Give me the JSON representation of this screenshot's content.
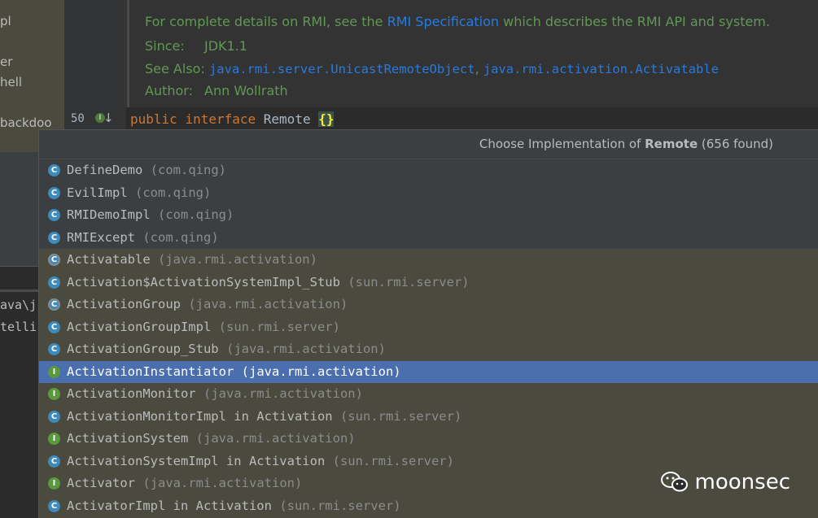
{
  "left_panel": {
    "items": [
      "pl",
      "er",
      "hell",
      "backdoo"
    ],
    "terminal_lines": [
      "ava\\j",
      "telli"
    ]
  },
  "editor": {
    "line_number": "50",
    "doc": {
      "line1_prefix": "For complete details on RMI, see the ",
      "line1_link": "RMI Specification",
      "line1_suffix": " which describes the RMI API and system.",
      "since_label": "Since:",
      "since_value": "JDK1.1",
      "see_also_label": "See Also:",
      "see_also_link1": "java.rmi.server.UnicastRemoteObject",
      "see_also_sep": ",",
      "see_also_link2": "java.rmi.activation.Activatable",
      "author_label": "Author:",
      "author_value": "Ann Wollrath"
    },
    "code": {
      "kw1": "public",
      "kw2": "interface",
      "name": "Remote",
      "braces": "{}"
    }
  },
  "popup": {
    "title_prefix": "Choose Implementation of ",
    "title_bold": "Remote",
    "title_suffix": " (656 found)",
    "rows": [
      {
        "name": "DefineDemo",
        "pkg": "(com.qing)",
        "icon": "class-icon",
        "group": "project"
      },
      {
        "name": "EvilImpl",
        "pkg": "(com.qing)",
        "icon": "class-icon",
        "group": "project"
      },
      {
        "name": "RMIDemoImpl",
        "pkg": "(com.qing)",
        "icon": "class-icon",
        "group": "project"
      },
      {
        "name": "RMIExcept",
        "pkg": "(com.qing)",
        "icon": "class-icon",
        "group": "project"
      },
      {
        "name": "Activatable",
        "pkg": "(java.rmi.activation)",
        "icon": "abstract-class-icon",
        "group": "library"
      },
      {
        "name": "Activation$ActivationSystemImpl_Stub",
        "pkg": "(sun.rmi.server)",
        "icon": "class-icon",
        "group": "library"
      },
      {
        "name": "ActivationGroup",
        "pkg": "(java.rmi.activation)",
        "icon": "abstract-class-icon",
        "group": "library"
      },
      {
        "name": "ActivationGroupImpl",
        "pkg": "(sun.rmi.server)",
        "icon": "class-icon",
        "group": "library"
      },
      {
        "name": "ActivationGroup_Stub",
        "pkg": "(java.rmi.activation)",
        "icon": "class-icon",
        "group": "library"
      },
      {
        "name": "ActivationInstantiator",
        "pkg": "(java.rmi.activation)",
        "icon": "interface-icon",
        "group": "library",
        "selected": true
      },
      {
        "name": "ActivationMonitor",
        "pkg": "(java.rmi.activation)",
        "icon": "interface-icon",
        "group": "library"
      },
      {
        "name": "ActivationMonitorImpl in Activation",
        "pkg": "(sun.rmi.server)",
        "icon": "class-icon",
        "group": "library"
      },
      {
        "name": "ActivationSystem",
        "pkg": "(java.rmi.activation)",
        "icon": "interface-icon",
        "group": "library"
      },
      {
        "name": "ActivationSystemImpl in Activation",
        "pkg": "(sun.rmi.server)",
        "icon": "class-icon",
        "group": "library"
      },
      {
        "name": "Activator",
        "pkg": "(java.rmi.activation)",
        "icon": "interface-icon",
        "group": "library"
      },
      {
        "name": "ActivatorImpl in Activation",
        "pkg": "(sun.rmi.server)",
        "icon": "class-icon",
        "group": "library"
      }
    ]
  },
  "watermark": {
    "text": "moonsec",
    "icon": "wechat-icon"
  },
  "colors": {
    "selection": "#4b6eaf",
    "doc_text": "#629755",
    "link": "#287bde",
    "keyword": "#cc7832"
  }
}
